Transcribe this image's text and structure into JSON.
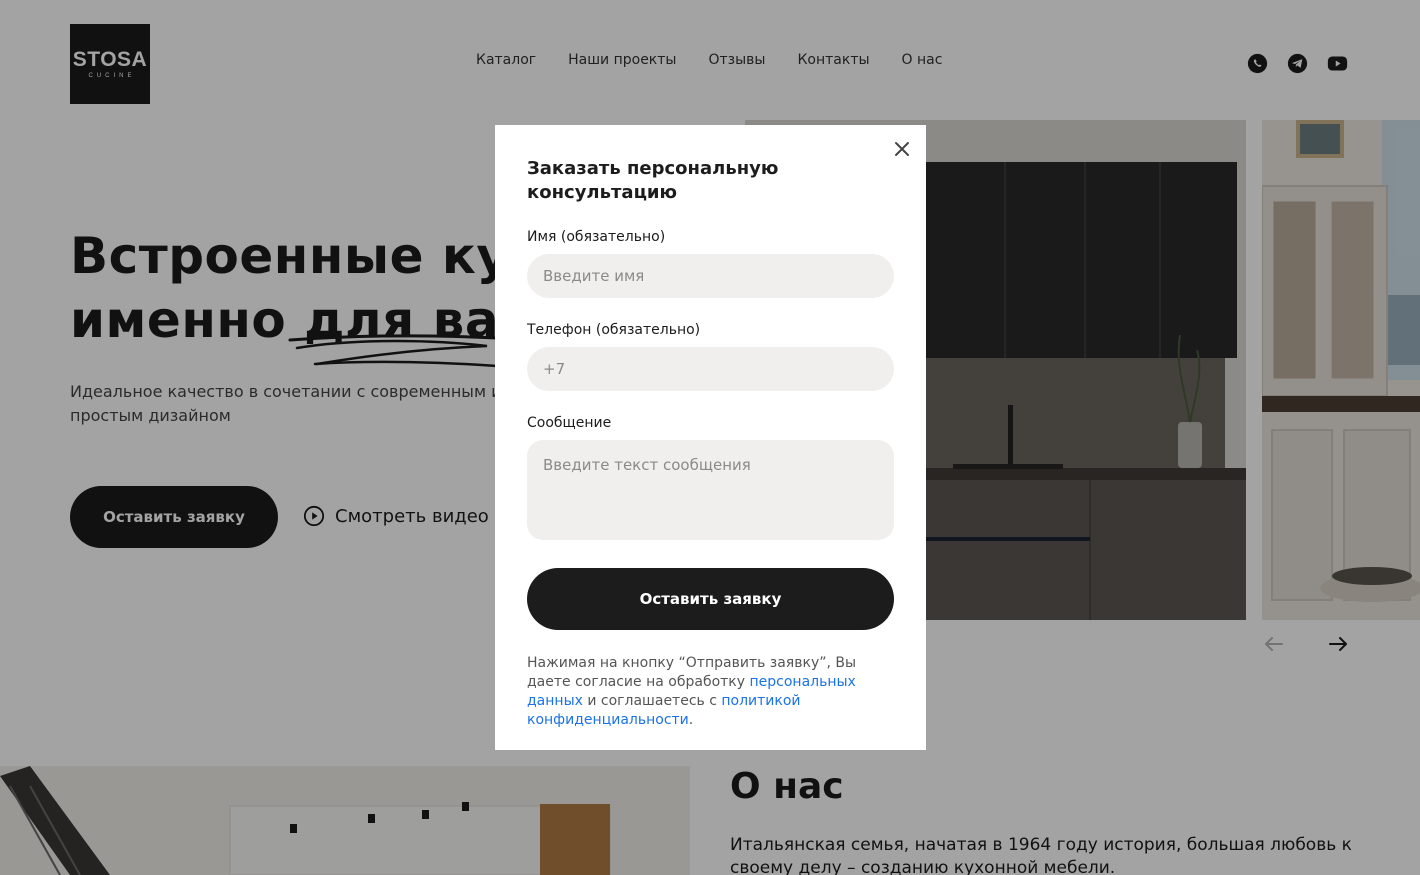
{
  "header": {
    "logo": {
      "main": "STOSA",
      "sub": "CUCINE"
    },
    "nav": [
      "Каталог",
      "Наши проекты",
      "Отзывы",
      "Контакты",
      "О нас"
    ],
    "socials": [
      "whatsapp-icon",
      "telegram-icon",
      "youtube-icon"
    ]
  },
  "hero": {
    "title_line1": "Встроенные ку",
    "title_line2": "именно для вас",
    "subtitle": "Идеальное качество в сочетании с современным и простым дизайном",
    "cta_label": "Оставить заявку",
    "video_label": "Смотреть видео"
  },
  "about": {
    "title": "О нас",
    "text": "Итальянская семья, начатая в 1964 году история, большая любовь к своему делу – созданию кухонной мебели."
  },
  "modal": {
    "title": "Заказать персональную консультацию",
    "name_label": "Имя (обязательно)",
    "name_placeholder": "Введите имя",
    "phone_label": "Телефон (обязательно)",
    "phone_placeholder": "+7",
    "message_label": "Сообщение",
    "message_placeholder": "Введите текст сообщения",
    "submit_label": "Оставить заявку",
    "consent_part1": "Нажимая на кнопку “Отправить заявку”, Вы даете согласие на обработку ",
    "consent_link1": "персональных данных",
    "consent_part2": " и соглашаетесь с ",
    "consent_link2": "политикой конфиденциальности",
    "consent_part3": "."
  },
  "colors": {
    "dark": "#1c1c1c",
    "input_bg": "#f0efed",
    "link": "#1a73e8",
    "overlay": "rgba(0,0,0,0.36)"
  }
}
